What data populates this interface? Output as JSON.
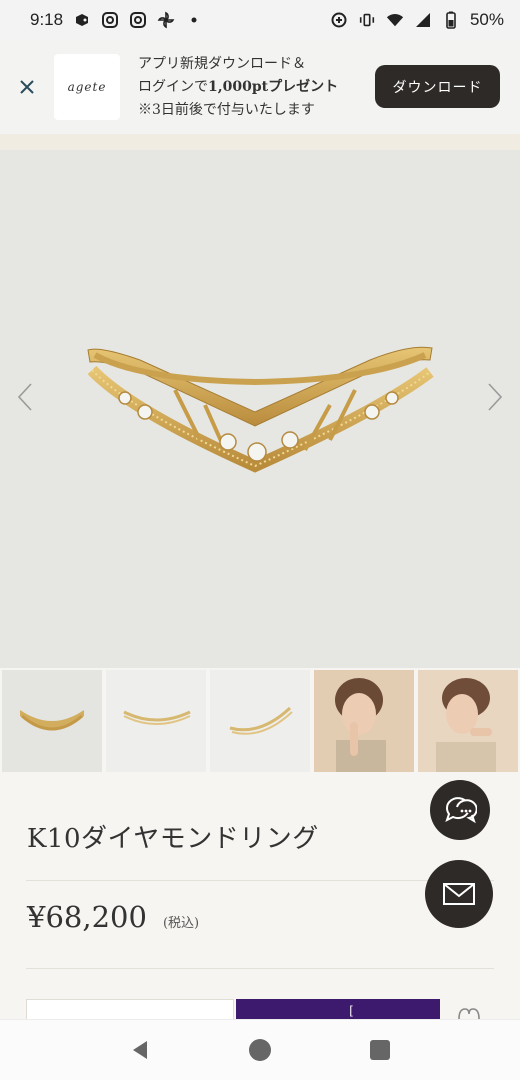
{
  "status_bar": {
    "time": "9:18",
    "battery": "50%",
    "left_icons": [
      "game-controller-icon",
      "instagram-icon",
      "instagram-icon",
      "pinwheel-icon",
      "dot-icon"
    ],
    "right_icons": [
      "data-saver-icon",
      "vibrate-icon",
      "wifi-icon",
      "signal-icon",
      "battery-icon"
    ]
  },
  "app_banner": {
    "close_icon": "close-icon",
    "logo_text": "agete",
    "line1": "アプリ新規ダウンロード＆",
    "line2_prefix": "ログインで",
    "line2_bold": "1,000ptプレゼント",
    "line3": "※3日前後で付与いたします",
    "download_label": "ダウンロード"
  },
  "hero": {
    "prev_icon": "chevron-left-icon",
    "next_icon": "chevron-right-icon"
  },
  "thumbnails": [
    {
      "kind": "ring",
      "active": true
    },
    {
      "kind": "ring",
      "active": false
    },
    {
      "kind": "ring",
      "active": false
    },
    {
      "kind": "model",
      "active": false
    },
    {
      "kind": "model",
      "active": false
    }
  ],
  "product": {
    "name": "K10ダイヤモンドリング",
    "price": "¥68,200",
    "tax_note": "(税込)"
  },
  "actions": {
    "purple_button_partial": "[",
    "favorite_icon": "heart-icon"
  },
  "floating": {
    "chat_icon": "chat-bubbles-icon",
    "mail_icon": "mail-icon"
  },
  "nav_bar": {
    "back_icon": "back-triangle-icon",
    "home_icon": "home-circle-icon",
    "recents_icon": "recents-square-icon"
  },
  "colors": {
    "banner_button": "#2e2a28",
    "purple_button": "#3e1a6e",
    "page_background": "#f7f5f1",
    "hero_background": "#e6e7e3",
    "gold": "#c9a24f"
  }
}
